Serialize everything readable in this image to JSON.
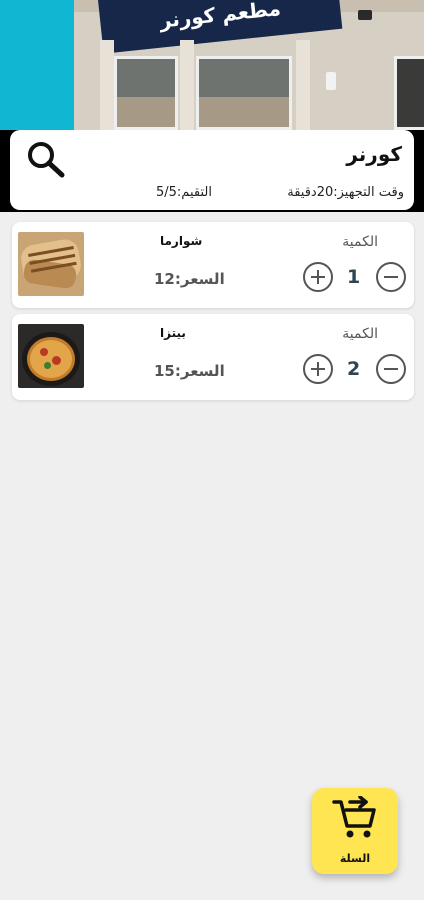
{
  "header": {
    "signboard_text": "مطعم كورنر",
    "colors": {
      "sky": "#0fb7d3",
      "signboard": "#16274a"
    }
  },
  "restaurant": {
    "name": "كورنر",
    "prep_time": "وقت التجهيز:20دقيقة",
    "rating": "التقيم:5/5"
  },
  "items": [
    {
      "name": "شوارما",
      "price": "السعر:12",
      "quantity_label": "الكمية",
      "quantity": "1",
      "image": "shawarma-image"
    },
    {
      "name": "بيتزا",
      "price": "السعر:15",
      "quantity_label": "الكمية",
      "quantity": "2",
      "image": "pizza-image"
    }
  ],
  "cart": {
    "label": "السلة",
    "icon": "cart-arrow-icon",
    "color": "#ffe552"
  },
  "icons": {
    "search": "search-icon",
    "plus": "plus-circle-icon",
    "minus": "minus-circle-icon"
  }
}
